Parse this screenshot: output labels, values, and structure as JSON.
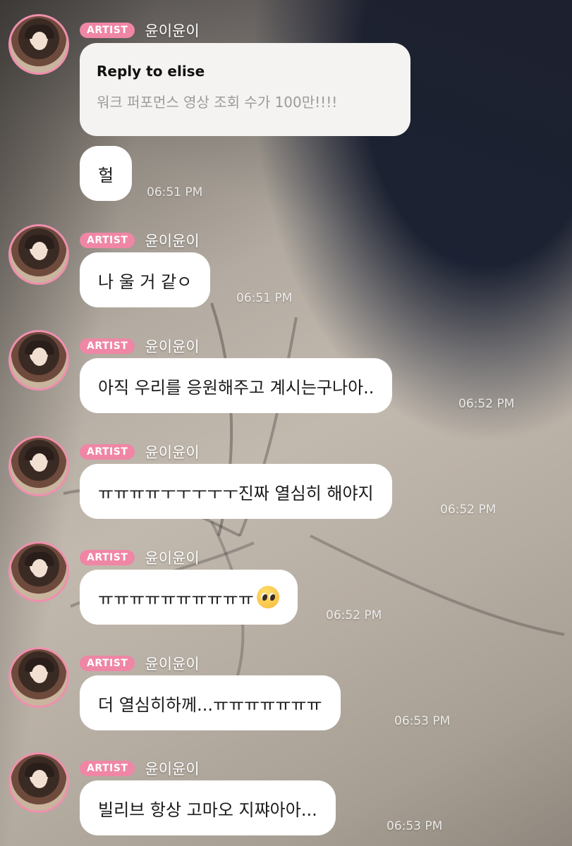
{
  "badge_label": "ARTIST",
  "sender_name": "윤이윤이",
  "colors": {
    "badge_bg": "#ef86a5",
    "avatar_ring": "#ef8fae",
    "bubble_bg": "#ffffff"
  },
  "reply": {
    "title": "Reply to elise",
    "quoted": "워크 퍼포먼스 영상 조회 수가 100만!!!!"
  },
  "messages": [
    {
      "text": "헐",
      "time": "06:51 PM"
    },
    {
      "text": "나 울 거 같ㅇ",
      "time": "06:51 PM"
    },
    {
      "text": "아직 우리를 응원해주고 계시는구나아..",
      "time": "06:52 PM"
    },
    {
      "text": "ㅠㅠㅠㅠㅜㅜㅜㅜㅜ진짜 열심히 해야지",
      "time": "06:52 PM"
    },
    {
      "text": "ㅠㅠㅠㅠㅠㅠㅠㅠㅠㅠ",
      "emoji": "pleading-face-icon",
      "time": "06:52 PM"
    },
    {
      "text": "더 열심히하께...ㅠㅠㅠㅠㅠㅠㅠ",
      "time": "06:53 PM"
    },
    {
      "text": "빌리브 항상 고마오 지쨔아아...",
      "time": "06:53 PM"
    }
  ]
}
